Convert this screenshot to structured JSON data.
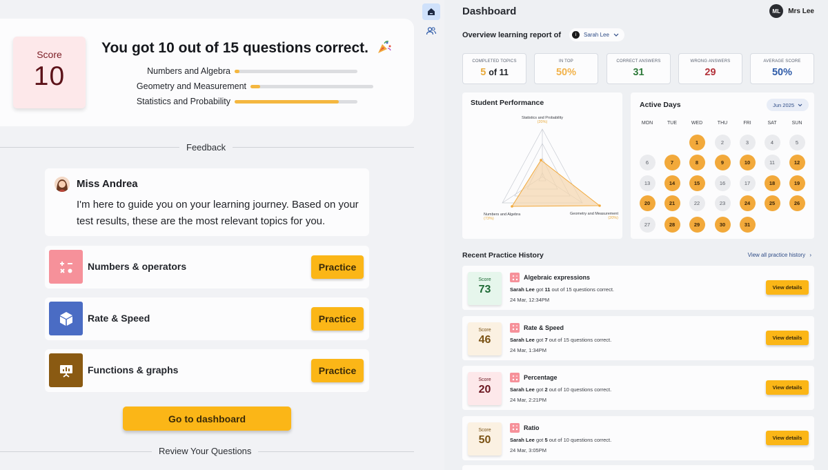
{
  "result": {
    "score_label": "Score",
    "score_value": "10",
    "title": "You got 10 out of 15 questions correct.",
    "topics": [
      {
        "name": "Numbers and Algebra",
        "progress": 0.04
      },
      {
        "name": "Geometry and Measurement",
        "progress": 0.08
      },
      {
        "name": "Statistics and Probability",
        "progress": 0.85
      }
    ]
  },
  "feedback": {
    "section_label": "Feedback",
    "teacher_name": "Miss Andrea",
    "message": "I'm here to guide you on your learning journey. Based on your test results, these are the most relevant topics for you.",
    "topics": [
      {
        "title": "Numbers & operators",
        "button": "Practice",
        "icon": "calculator-icon",
        "color": "#f6919a"
      },
      {
        "title": "Rate & Speed",
        "button": "Practice",
        "icon": "cube-icon",
        "color": "#4a6cc4"
      },
      {
        "title": "Functions & graphs",
        "button": "Practice",
        "icon": "presentation-chart-icon",
        "color": "#8a5a12"
      }
    ],
    "dashboard_button": "Go to dashboard",
    "review_label": "Review Your Questions"
  },
  "rail": {
    "items": [
      {
        "icon": "home-icon",
        "active": true
      },
      {
        "icon": "users-icon",
        "active": false
      }
    ]
  },
  "dashboard": {
    "title": "Dashboard",
    "user": {
      "initials": "ML",
      "name": "Mrs Lee"
    },
    "overview_label": "Overview learning report of",
    "student": {
      "initial": "i",
      "name": "Sarah Lee"
    },
    "stats": [
      {
        "label": "COMPLETED TOPICS",
        "value": "5",
        "suffix": "of 11",
        "color": "#e8a93a"
      },
      {
        "label": "IN TOP",
        "value": "50%",
        "color": "#f2b24a"
      },
      {
        "label": "CORRECT ANSWERS",
        "value": "31",
        "color": "#2e7a3a"
      },
      {
        "label": "WRONG ANSWERS",
        "value": "29",
        "color": "#b3323a"
      },
      {
        "label": "AVERAGE SCORE",
        "value": "50%",
        "color": "#2d5aa8"
      }
    ],
    "performance": {
      "title": "Student Performance",
      "axes": [
        {
          "name": "Statistics and Probability",
          "value": "(20%)"
        },
        {
          "name": "Numbers and Algebra",
          "value": "(73%)"
        },
        {
          "name": "Geometry and Measurement",
          "value": "(20%)"
        }
      ]
    },
    "active_days": {
      "title": "Active Days",
      "month": "Jun 2025",
      "weekdays": [
        "MON",
        "TUE",
        "WED",
        "THU",
        "FRI",
        "SAT",
        "SUN"
      ],
      "active": [
        1,
        7,
        8,
        9,
        10,
        12,
        14,
        15,
        18,
        19,
        20,
        21,
        24,
        25,
        26,
        28,
        29,
        30,
        31
      ]
    },
    "history_title": "Recent Practice History",
    "view_all": "View all practice history",
    "history": [
      {
        "score_label": "Score",
        "score": "73",
        "topic": "Algebraic expressions",
        "student": "Sarah Lee",
        "got": "got",
        "correct": "11",
        "rest": "out of 15 questions correct.",
        "date": "24 Mar, 12:34PM",
        "button": "View details",
        "bg": "#e6f6ec",
        "fg": "#1e6a35"
      },
      {
        "score_label": "Score",
        "score": "46",
        "topic": "Rate & Speed",
        "student": "Sarah Lee",
        "got": "got",
        "correct": "7",
        "rest": "out of 15 questions correct.",
        "date": "24 Mar, 1:34PM",
        "button": "View details",
        "bg": "#fbf1e2",
        "fg": "#7a5214"
      },
      {
        "score_label": "Score",
        "score": "20",
        "topic": "Percentage",
        "student": "Sarah Lee",
        "got": "got",
        "correct": "2",
        "rest": "out of 10 questions correct.",
        "date": "24 Mar, 2:21PM",
        "button": "View details",
        "bg": "#fde8ea",
        "fg": "#6b1620"
      },
      {
        "score_label": "Score",
        "score": "50",
        "topic": "Ratio",
        "student": "Sarah Lee",
        "got": "got",
        "correct": "5",
        "rest": "out of 10 questions correct.",
        "date": "24 Mar, 3:05PM",
        "button": "View details",
        "bg": "#fbf1e2",
        "fg": "#7a5214"
      }
    ]
  }
}
